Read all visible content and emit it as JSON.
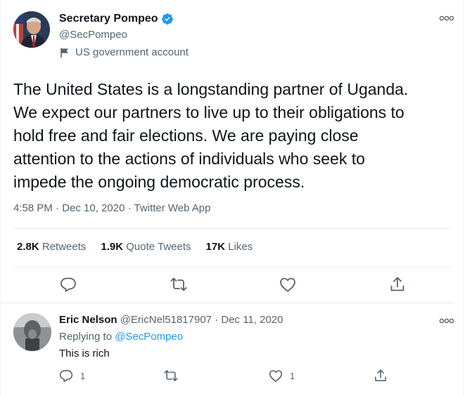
{
  "tweet": {
    "display_name": "Secretary Pompeo",
    "handle": "@SecPompeo",
    "gov_label": "US government account",
    "text": "The United States is a longstanding partner of Uganda.\nWe expect our partners to live up to their obligations to\nhold free and fair elections. We are paying close\nattention to the actions of individuals who seek to\nimpede the ongoing democratic process.",
    "time": "4:58 PM",
    "date": "Dec 10, 2020",
    "source": "Twitter Web App",
    "meta_sep": "·"
  },
  "stats": {
    "retweets_count": "2.8K",
    "retweets_label": "Retweets",
    "quotes_count": "1.9K",
    "quotes_label": "Quote Tweets",
    "likes_count": "17K",
    "likes_label": "Likes"
  },
  "reply": {
    "display_name": "Eric Nelson",
    "handle": "@EricNel51817907",
    "sep": "·",
    "date": "Dec 11, 2020",
    "replying_prefix": "Replying to",
    "replying_to": "@SecPompeo",
    "text": "This is rich",
    "reply_count": "1",
    "like_count": "1"
  },
  "colors": {
    "accent": "#1d9bf0",
    "secondary_text": "#536471",
    "primary_text": "#0f1419",
    "divider": "#e7ecef"
  },
  "icons": [
    "verified-badge-icon",
    "flag-icon",
    "more-icon",
    "reply-icon",
    "retweet-icon",
    "like-icon",
    "share-icon"
  ]
}
